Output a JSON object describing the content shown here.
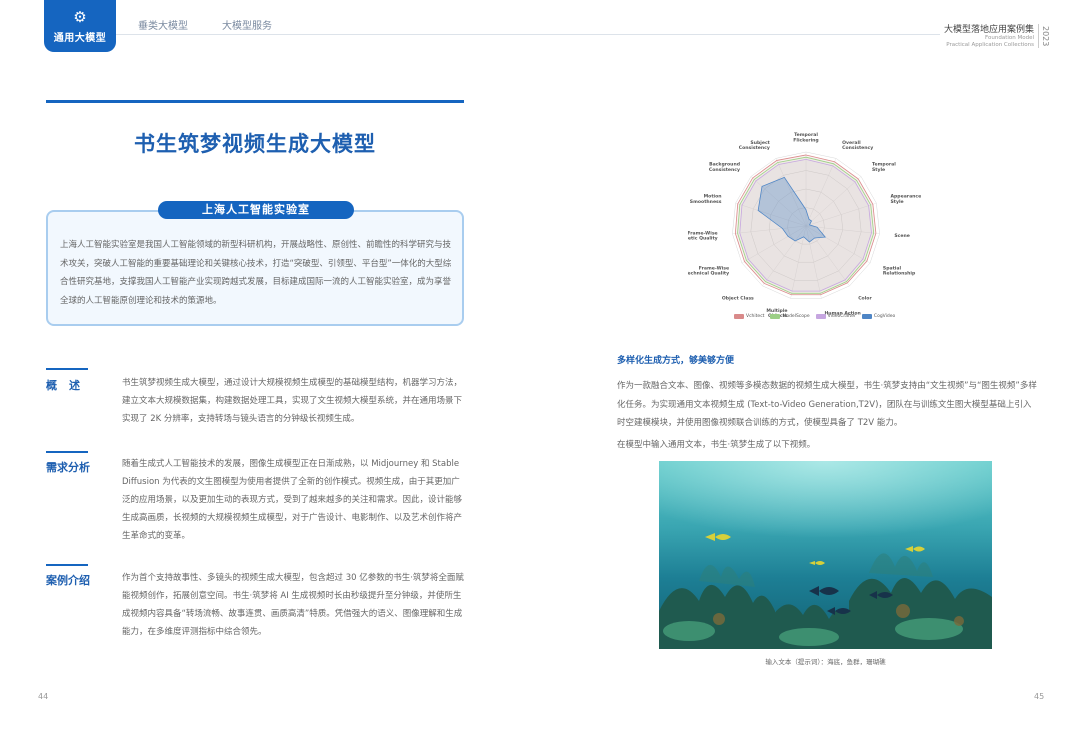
{
  "header": {
    "tab_label": "通用大模型",
    "nav": [
      "垂类大模型",
      "大模型服务"
    ],
    "brand_title": "大模型落地应用案例集",
    "brand_sub1": "Foundation Model",
    "brand_sub2": "Practical Application Collections",
    "year": "2023"
  },
  "left": {
    "title": "书生筑梦视频生成大模型",
    "org_label": "上海人工智能实验室",
    "org_text": "上海人工智能实验室是我国人工智能领域的新型科研机构，开展战略性、原创性、前瞻性的科学研究与技术攻关，突破人工智能的重要基础理论和关键核心技术，打造“突破型、引领型、平台型”一体化的大型综合性研究基地，支撑我国人工智能产业实现跨越式发展，目标建成国际一流的人工智能实验室，成为享誉全球的人工智能原创理论和技术的策源地。",
    "sections": [
      {
        "title": "概述",
        "body": "书生筑梦视频生成大模型，通过设计大规模视频生成模型的基础模型结构，机器学习方法，建立文本大规模数据集，构建数据处理工具，实现了文生视频大模型系统，并在通用场景下实现了 2K 分辨率，支持转场与镜头语言的分钟级长视频生成。"
      },
      {
        "title": "需求分析",
        "body": "随着生成式人工智能技术的发展，图像生成模型正在日渐成熟，以 Midjourney 和 Stable Diffusion 为代表的文生图模型为使用者提供了全新的创作模式。视频生成，由于其更加广泛的应用场景，以及更加生动的表现方式，受到了越来越多的关注和需求。因此，设计能够生成高画质，长视频的大规模视频生成模型，对于广告设计、电影制作、以及艺术创作将产生革命式的变革。"
      },
      {
        "title": "案例介绍",
        "body": "作为首个支持故事性、多镜头的视频生成大模型，包含超过 30 亿参数的书生·筑梦将全面赋能视频创作，拓展创意空间。书生·筑梦将 AI 生成视频时长由秒级提升至分钟级，并使所生成视频内容具备“转场流畅、故事连贯、画质高清”特质。凭借强大的语义、图像理解和生成能力，在多维度评测指标中综合领先。"
      }
    ]
  },
  "right": {
    "heading": "多样化生成方式，够美够方便",
    "body": "作为一款融合文本、图像、视频等多模态数据的视频生成大模型，书生·筑梦支持由“文生视频”与“图生视频”多样化任务。为实现通用文本视频生成 (Text-to-Video Generation,T2V)，团队在与训练文生图大模型基础上引入时空建模模块，并使用图像视频联合训练的方式，使模型具备了 T2V 能力。",
    "intro": "在模型中输入通用文本，书生·筑梦生成了以下视频。",
    "caption": "输入文本（提示词）：海底，鱼群，珊瑚礁"
  },
  "chart_data": {
    "type": "radar",
    "axes": [
      "Temporal Flickering",
      "Overall Consistency",
      "Temporal Style",
      "Appearance Style",
      "Scene",
      "Spatial Relationship",
      "Color",
      "Human Action",
      "Multiple Objects",
      "Object Class",
      "Frame-Wise Technical Quality",
      "Frame-Wise Aesthetic Quality",
      "Motion Smoothness",
      "Background Consistency",
      "Subject Consistency"
    ],
    "range": [
      0,
      1
    ],
    "grid": true,
    "legend_position": "bottom",
    "series": [
      {
        "name": "Vchitect",
        "color": "#d98a8a",
        "values": [
          0.96,
          0.95,
          0.95,
          0.95,
          0.95,
          0.95,
          0.95,
          0.95,
          0.95,
          0.96,
          0.96,
          0.96,
          0.97,
          0.97,
          0.97
        ]
      },
      {
        "name": "ModelScope",
        "color": "#9ccf86",
        "values": [
          0.93,
          0.92,
          0.92,
          0.92,
          0.92,
          0.92,
          0.93,
          0.93,
          0.93,
          0.93,
          0.93,
          0.93,
          0.94,
          0.94,
          0.94
        ]
      },
      {
        "name": "VideoCrafter",
        "color": "#c6a6e0",
        "values": [
          0.9,
          0.89,
          0.89,
          0.89,
          0.89,
          0.89,
          0.9,
          0.9,
          0.9,
          0.9,
          0.9,
          0.9,
          0.91,
          0.91,
          0.91
        ]
      },
      {
        "name": "CogVideo",
        "color": "#4f86c6",
        "values": [
          0.22,
          0.1,
          0.1,
          0.05,
          0.15,
          0.3,
          0.2,
          0.22,
          0.15,
          0.25,
          0.28,
          0.32,
          0.68,
          0.8,
          0.72
        ]
      }
    ]
  },
  "page_numbers": {
    "left": "44",
    "right": "45"
  },
  "colors": {
    "accent": "#1565c0",
    "heading": "#1e5fb0"
  }
}
